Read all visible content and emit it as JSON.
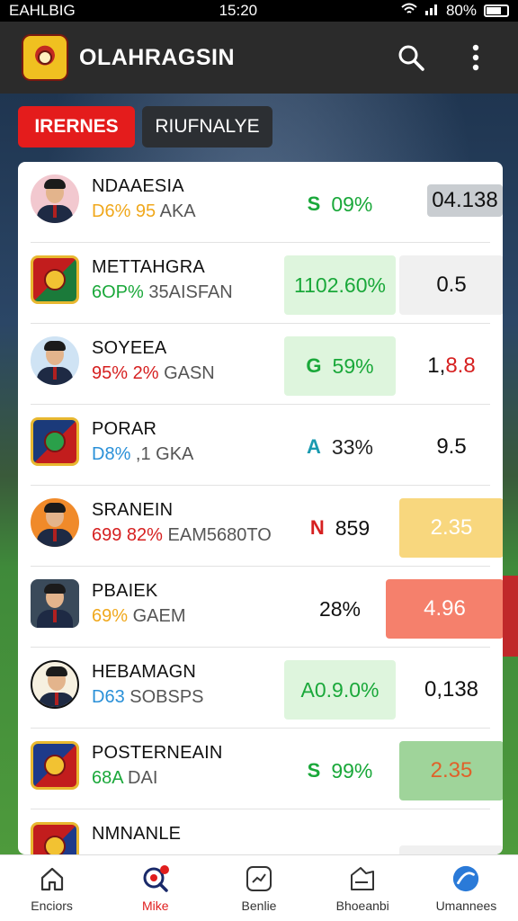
{
  "status": {
    "carrier": "EAHLBIG",
    "time": "15:20",
    "battery": "80%"
  },
  "app": {
    "title": "OLAHRAGSIN"
  },
  "tabs": [
    {
      "label": "IRERNES",
      "active": true
    },
    {
      "label": "RIUFNALYE",
      "active": false
    }
  ],
  "rows": [
    {
      "name": "NDAAESIA",
      "meta_a": "D6% 95",
      "meta_b": "AKA",
      "meta_a_color": "#f0a81c",
      "mark": "S",
      "mark_color": "#1aa83a",
      "pct": "09%",
      "pct_color": "#1aa83a",
      "odds": "04.138"
    },
    {
      "name": "METTAHGRA",
      "meta_a": "6OP%",
      "meta_b": "35AISFAN",
      "meta_a_color": "#1aa83a",
      "mark": "",
      "mark_color": "#1aa83a",
      "pct": "1102.60%",
      "pct_color": "#1aa83a",
      "odds": "0.5"
    },
    {
      "name": "SOYEEA",
      "meta_a": "95% 2%",
      "meta_b": "GASN",
      "meta_a_color": "#d62020",
      "mark": "G",
      "mark_color": "#1aa83a",
      "pct": "59%",
      "pct_color": "#1aa83a",
      "odds": "1,8.8"
    },
    {
      "name": "PORAR",
      "meta_a": "D8%",
      "meta_b": ",1 GKA",
      "meta_a_color": "#2a90d8",
      "mark": "A",
      "mark_color": "#1a9ab0",
      "pct": "33%",
      "pct_color": "#333333",
      "odds": "9.5"
    },
    {
      "name": "SRANEIN",
      "meta_a": "699 82%",
      "meta_b": "EAM5680TO",
      "meta_a_color": "#d62020",
      "mark": "N",
      "mark_color": "#d62020",
      "pct": "859",
      "pct_color": "#111111",
      "odds": "2.35"
    },
    {
      "name": "PBAIEK",
      "meta_a": "69%",
      "meta_b": "GAEM",
      "meta_a_color": "#f0a81c",
      "mark": "",
      "mark_color": "#111111",
      "pct": "28%",
      "pct_color": "#111111",
      "odds": "4.96"
    },
    {
      "name": "HEBAMAGN",
      "meta_a": "D63",
      "meta_b": "SOBSPS",
      "meta_a_color": "#2a90d8",
      "mark": "",
      "mark_color": "#1aa83a",
      "pct": "A0.9.0%",
      "pct_color": "#1aa83a",
      "odds": "0,138"
    },
    {
      "name": "POSTERNEAIN",
      "meta_a": "68A",
      "meta_b": "DAI",
      "meta_a_color": "#1aa83a",
      "mark": "S",
      "mark_color": "#1aa83a",
      "pct": "99%",
      "pct_color": "#1aa83a",
      "odds": "2.35"
    },
    {
      "name": "NMNANLE",
      "meta_a": "",
      "meta_b": "",
      "meta_a_color": "#2a90d8",
      "mark": "",
      "mark_color": "#111111",
      "pct": "",
      "pct_color": "#111111",
      "odds": ""
    }
  ],
  "bottom_nav": [
    {
      "label": "Enciors",
      "icon": "home-icon",
      "active": false
    },
    {
      "label": "Mike",
      "icon": "search-notification-icon",
      "active": true
    },
    {
      "label": "Benlie",
      "icon": "chart-card-icon",
      "active": false
    },
    {
      "label": "Bhoeanbi",
      "icon": "ticket-icon",
      "active": false
    },
    {
      "label": "Umannees",
      "icon": "globe-icon",
      "active": false
    }
  ]
}
